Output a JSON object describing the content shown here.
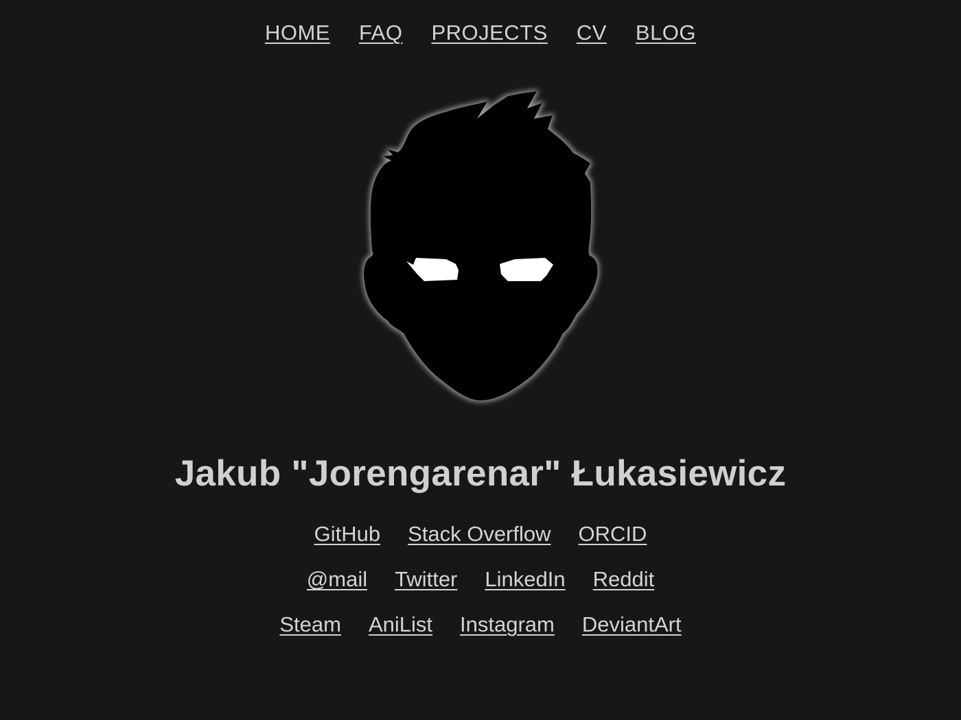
{
  "nav": {
    "items": [
      {
        "label": "HOME"
      },
      {
        "label": "FAQ"
      },
      {
        "label": "PROJECTS"
      },
      {
        "label": "CV"
      },
      {
        "label": "BLOG"
      }
    ]
  },
  "avatar": {
    "icon": "silhouette-head-icon",
    "fill_color": "#000000",
    "glow_color": "#9a9a9a",
    "eye_color": "#ffffff"
  },
  "profile": {
    "name": "Jakub \"Jorengarenar\" Łukasiewicz"
  },
  "links": {
    "row1": [
      {
        "label": "GitHub"
      },
      {
        "label": "Stack Overflow"
      },
      {
        "label": "ORCID"
      }
    ],
    "row2": [
      {
        "label": "@mail"
      },
      {
        "label": "Twitter"
      },
      {
        "label": "LinkedIn"
      },
      {
        "label": "Reddit"
      }
    ],
    "row3": [
      {
        "label": "Steam"
      },
      {
        "label": "AniList"
      },
      {
        "label": "Instagram"
      },
      {
        "label": "DeviantArt"
      }
    ]
  },
  "colors": {
    "background": "#17171a",
    "text": "#d4d4d4"
  }
}
